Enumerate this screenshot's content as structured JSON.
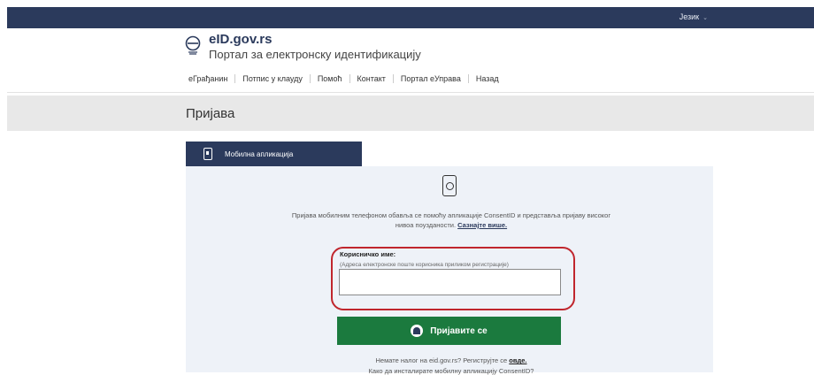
{
  "topbar": {
    "language_label": "Језик",
    "language_caret": "⌄"
  },
  "header": {
    "brand": "eID.gov.rs",
    "tagline": "Портал за електронску идентификацију"
  },
  "nav": {
    "items": [
      {
        "label": "еГрађанин"
      },
      {
        "label": "Потпис у клауду"
      },
      {
        "label": "Помоћ"
      },
      {
        "label": "Контакт"
      },
      {
        "label": "Портал еУправа"
      },
      {
        "label": "Назад"
      }
    ]
  },
  "page": {
    "title": "Пријава"
  },
  "tab": {
    "label": "Мобилна апликација"
  },
  "panel": {
    "description": "Пријава мобилним телефоном обавља се помоћу апликације ConsentID и представља пријаву високог нивоа поузданости.",
    "learn_more": "Сазнајте више.",
    "username_label": "Корисничко име:",
    "username_hint": "(Адреса електронске поште корисника приликом регистрације)",
    "username_value": "",
    "login_button": "Пријавите се",
    "register_prefix": "Немате налог на eid.gov.rs? Региструјте се",
    "register_link": "овде.",
    "install_text": "Како да инсталирате мобилну апликацију ConsentID?"
  },
  "colors": {
    "navy": "#2b3a5c",
    "green": "#1b7a3e",
    "highlight": "#c0262d"
  }
}
